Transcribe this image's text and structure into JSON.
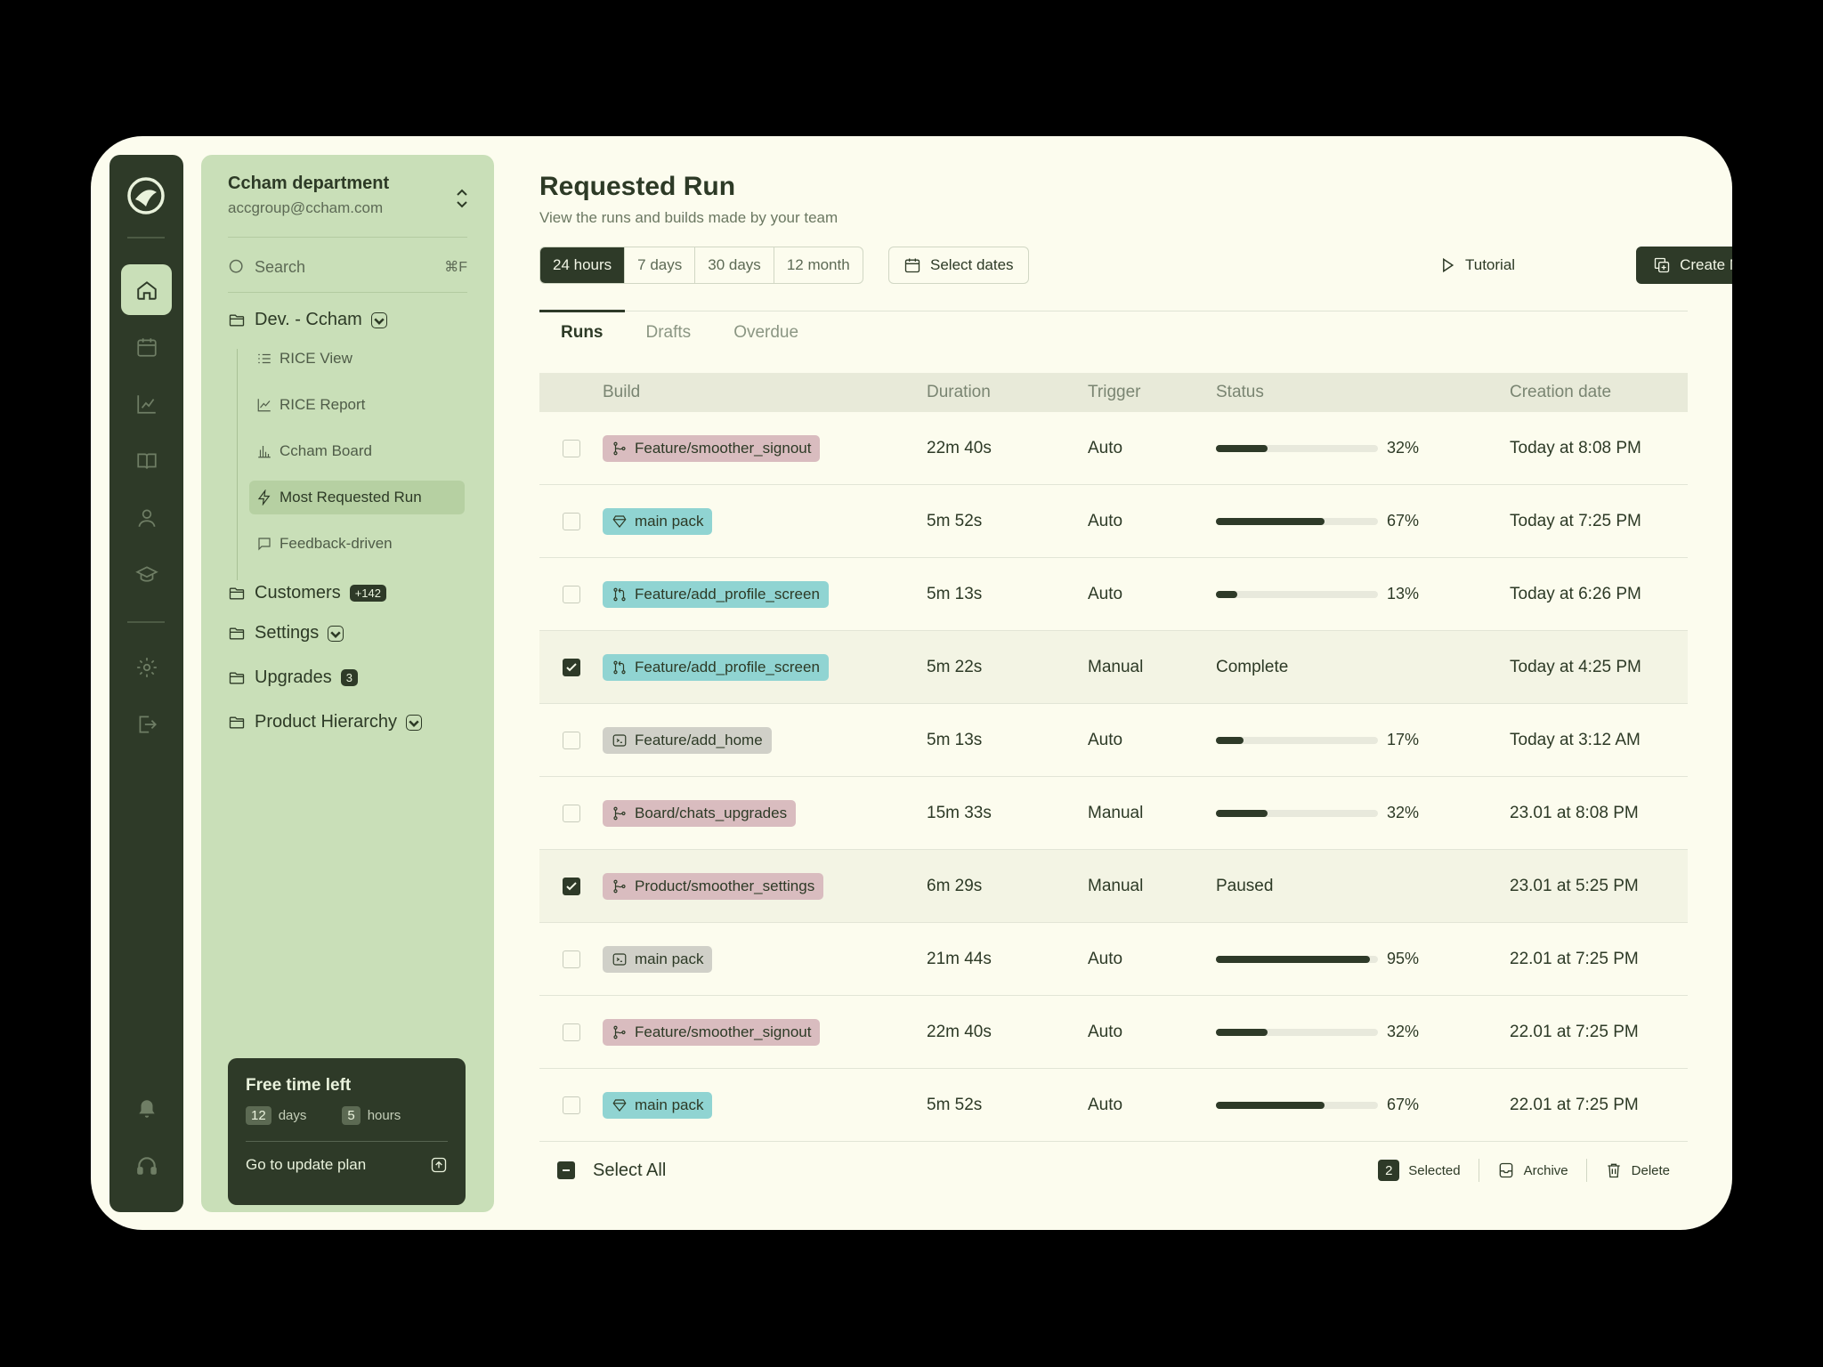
{
  "org": {
    "name": "Ccham department",
    "email": "accgroup@ccham.com"
  },
  "search": {
    "placeholder": "Search",
    "shortcut": "⌘F"
  },
  "nav": {
    "group": "Dev. - Ccham",
    "subitems": [
      {
        "label": "RICE View",
        "icon": "list-icon"
      },
      {
        "label": "RICE Report",
        "icon": "line-chart-icon"
      },
      {
        "label": "Ccham Board",
        "icon": "bar-chart-icon"
      },
      {
        "label": "Most Requested Run",
        "icon": "bolt-icon"
      },
      {
        "label": "Feedback-driven",
        "icon": "chat-icon"
      }
    ],
    "customers": "Customers",
    "customers_badge": "+142",
    "settings": "Settings",
    "upgrades": "Upgrades",
    "upgrades_badge": "3",
    "hierarchy": "Product Hierarchy"
  },
  "promo": {
    "title": "Free time left",
    "days_num": "12",
    "days_label": "days",
    "hours_num": "5",
    "hours_label": "hours",
    "cta": "Go to update plan"
  },
  "page": {
    "title": "Requested Run",
    "subtitle": "View the runs and builds made by your team"
  },
  "ranges": [
    "24 hours",
    "7 days",
    "30 days",
    "12 month"
  ],
  "actions": {
    "select_dates": "Select dates",
    "tutorial": "Tutorial",
    "create": "Create New"
  },
  "tabs": [
    "Runs",
    "Drafts",
    "Overdue"
  ],
  "table": {
    "columns": [
      "Build",
      "Duration",
      "Trigger",
      "Status",
      "Creation date"
    ],
    "rows": [
      {
        "build": "Feature/smoother_signout",
        "tag": "branch",
        "duration": "22m 40s",
        "trigger": "Auto",
        "progress": 32,
        "pct": "32%",
        "status": "",
        "date": "Today at 8:08 PM",
        "checked": false
      },
      {
        "build": "main pack",
        "tag": "package",
        "duration": "5m 52s",
        "trigger": "Auto",
        "progress": 67,
        "pct": "67%",
        "status": "",
        "date": "Today at 7:25 PM",
        "checked": false
      },
      {
        "build": "Feature/add_profile_screen",
        "tag": "pr",
        "duration": "5m 13s",
        "trigger": "Auto",
        "progress": 13,
        "pct": "13%",
        "status": "",
        "date": "Today at 6:26 PM",
        "checked": false
      },
      {
        "build": "Feature/add_profile_screen",
        "tag": "pr",
        "duration": "5m 22s",
        "trigger": "Manual",
        "progress": null,
        "pct": "",
        "status": "Complete",
        "date": "Today at 4:25 PM",
        "checked": true
      },
      {
        "build": "Feature/add_home",
        "tag": "terminal",
        "duration": "5m 13s",
        "trigger": "Auto",
        "progress": 17,
        "pct": "17%",
        "status": "",
        "date": "Today at 3:12 AM",
        "checked": false
      },
      {
        "build": "Board/chats_upgrades",
        "tag": "branch",
        "duration": "15m 33s",
        "trigger": "Manual",
        "progress": 32,
        "pct": "32%",
        "status": "",
        "date": "23.01 at 8:08 PM",
        "checked": false
      },
      {
        "build": "Product/smoother_settings",
        "tag": "branch",
        "duration": "6m 29s",
        "trigger": "Manual",
        "progress": null,
        "pct": "",
        "status": "Paused",
        "date": "23.01 at 5:25 PM",
        "checked": true
      },
      {
        "build": "main pack",
        "tag": "terminal",
        "duration": "21m 44s",
        "trigger": "Auto",
        "progress": 95,
        "pct": "95%",
        "status": "",
        "date": "22.01 at 7:25 PM",
        "checked": false
      },
      {
        "build": "Feature/smoother_signout",
        "tag": "branch",
        "duration": "22m 40s",
        "trigger": "Auto",
        "progress": 32,
        "pct": "32%",
        "status": "",
        "date": "22.01 at 7:25 PM",
        "checked": false
      },
      {
        "build": "main pack",
        "tag": "package",
        "duration": "5m 52s",
        "trigger": "Auto",
        "progress": 67,
        "pct": "67%",
        "status": "",
        "date": "22.01 at 7:25 PM",
        "checked": false
      }
    ]
  },
  "footer": {
    "select_all": "Select All",
    "selected_count": "2",
    "selected_label": "Selected",
    "archive": "Archive",
    "delete": "Delete"
  },
  "colors": {
    "branch": "#d9bcbf",
    "package": "#90d4d2",
    "pr": "#90d4d2",
    "terminal": "#d0d0c8",
    "accent": "#2e3a28",
    "sidebar": "#c9dfb8"
  }
}
